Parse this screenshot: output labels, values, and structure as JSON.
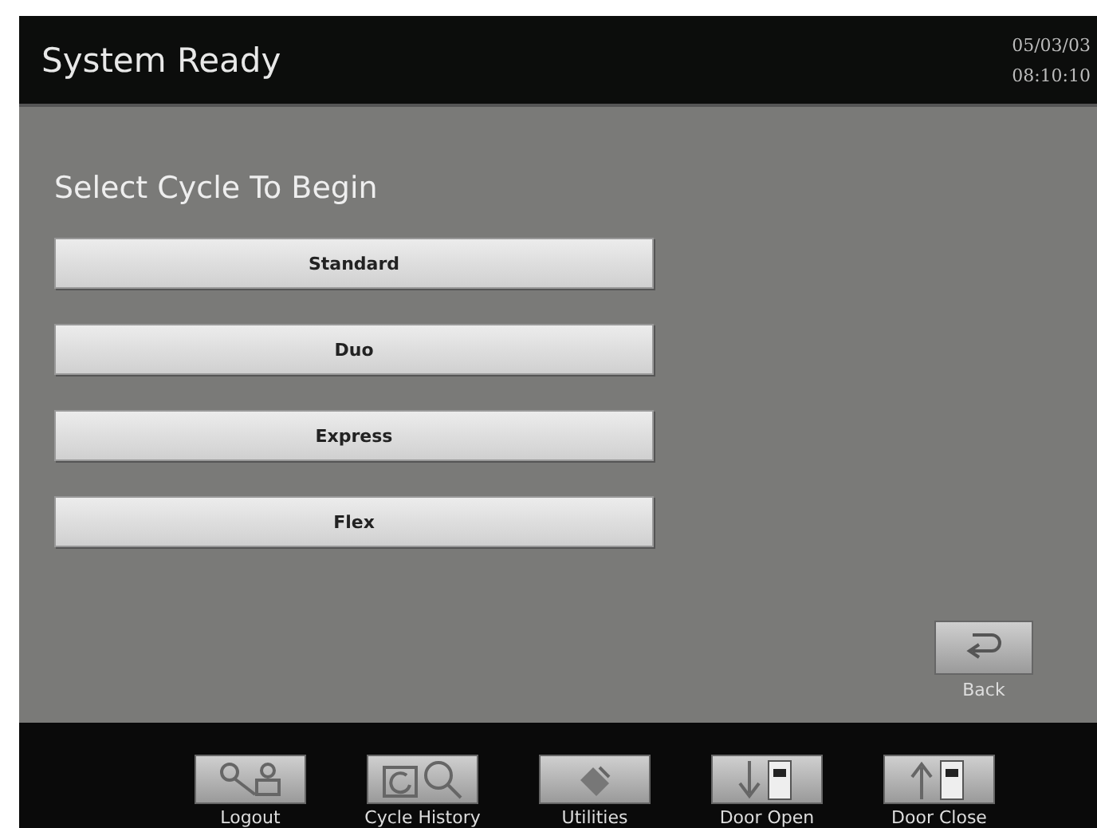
{
  "header": {
    "title": "System Ready",
    "date": "05/03/03",
    "time": "08:10:10"
  },
  "prompt": "Select Cycle To Begin",
  "cycles": [
    "Standard",
    "Duo",
    "Express",
    "Flex"
  ],
  "back": {
    "label": "Back"
  },
  "toolbar": [
    {
      "kind": "logout",
      "label": "Logout"
    },
    {
      "kind": "history",
      "label": "Cycle History"
    },
    {
      "kind": "utilities",
      "label": "Utilities"
    },
    {
      "kind": "door_open",
      "label": "Door Open"
    },
    {
      "kind": "door_close",
      "label": "Door Close"
    }
  ]
}
